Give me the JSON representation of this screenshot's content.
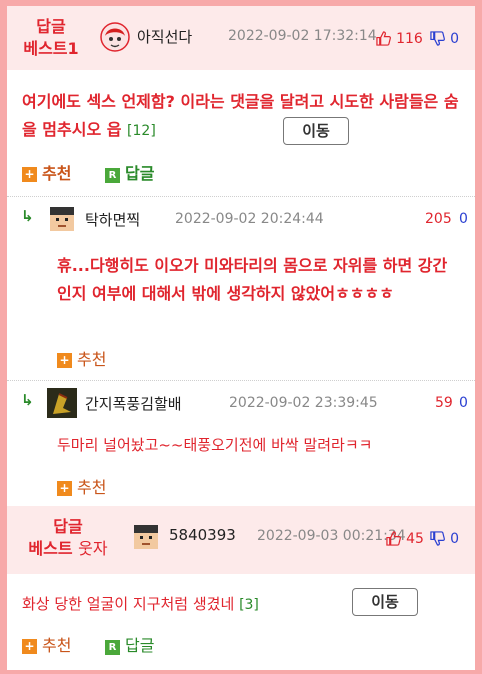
{
  "colors": {
    "accent_red": "#e0252e",
    "vote_blue": "#2a3fd1",
    "recommend_orange": "#f08a1d",
    "reply_green": "#4aa83a",
    "frame_pink": "#f7a9a9"
  },
  "best_comment": {
    "rank_line1": "답글",
    "rank_line2": "베스트1",
    "nickname": "아직선다",
    "date": "2022-09-02 17:32:14",
    "upvotes": "116",
    "downvotes": "0",
    "text": "여기에도 섹스 언제함? 이라는 댓글을 달려고 시도한 사람들은 숨을 멈추시오 읍",
    "reply_count": "[12]",
    "move_label": "이동",
    "recommend_label": "추천",
    "reply_label": "답글"
  },
  "replies": [
    {
      "nickname": "탁하면찍",
      "date": "2022-09-02 20:24:44",
      "upvotes": "205",
      "downvotes": "0",
      "text": "휴...다행히도 이오가 미와타리의 몸으로 자위를 하면 강간인지 여부에 대해서 밖에 생각하지 않았어ㅎㅎㅎㅎ",
      "recommend_label": "추천"
    },
    {
      "nickname": "간지폭풍김할배",
      "date": "2022-09-02 23:39:45",
      "upvotes": "59",
      "downvotes": "0",
      "text": "두마리 널어놨고~~태풍오기전에 바싹 말려라ㅋㅋ",
      "recommend_label": "추천"
    }
  ],
  "second_best": {
    "rank_line1": "답글",
    "rank_line2_a": "베스트",
    "rank_line2_b": "웃자",
    "nickname": "5840393",
    "date": "2022-09-03 00:21:34",
    "upvotes": "45",
    "downvotes": "0",
    "text": "화상 당한 얼굴이 지구처럼 생겼네",
    "reply_count": "[3]",
    "move_label": "이동",
    "recommend_label": "추천",
    "reply_label": "답글"
  }
}
